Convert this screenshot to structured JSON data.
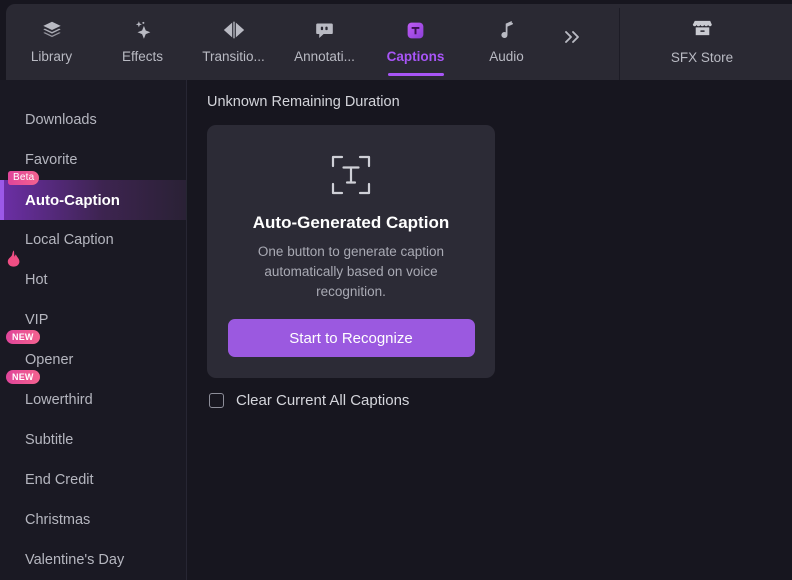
{
  "toolbar": {
    "tabs": [
      {
        "label": "Library",
        "icon": "layers-icon",
        "active": false
      },
      {
        "label": "Effects",
        "icon": "sparkle-icon",
        "active": false
      },
      {
        "label": "Transitio...",
        "icon": "transition-icon",
        "active": false
      },
      {
        "label": "Annotati...",
        "icon": "speech-bubble-icon",
        "active": false
      },
      {
        "label": "Captions",
        "icon": "captions-t-icon",
        "active": true
      },
      {
        "label": "Audio",
        "icon": "music-note-icon",
        "active": false
      }
    ],
    "overflow_icon": "chevron-double-right-icon",
    "store": {
      "label": "SFX Store",
      "icon": "storefront-icon"
    }
  },
  "sidebar": {
    "items": [
      {
        "label": "Downloads",
        "badge": null,
        "active": false
      },
      {
        "label": "Favorite",
        "badge": null,
        "active": false
      },
      {
        "label": "Auto-Caption",
        "badge": "Beta",
        "badge_type": "beta",
        "active": true
      },
      {
        "label": "Local Caption",
        "badge": null,
        "active": false
      },
      {
        "label": "Hot",
        "badge": null,
        "badge_type": "flame",
        "active": false
      },
      {
        "label": "VIP",
        "badge": null,
        "active": false
      },
      {
        "label": "Opener",
        "badge": "NEW",
        "badge_type": "new",
        "active": false
      },
      {
        "label": "Lowerthird",
        "badge": "NEW",
        "badge_type": "new",
        "active": false
      },
      {
        "label": "Subtitle",
        "badge": null,
        "active": false
      },
      {
        "label": "End Credit",
        "badge": null,
        "active": false
      },
      {
        "label": "Christmas",
        "badge": null,
        "active": false
      },
      {
        "label": "Valentine's Day",
        "badge": null,
        "active": false
      }
    ]
  },
  "main": {
    "heading": "Unknown Remaining Duration",
    "card": {
      "icon": "text-recognition-icon",
      "title": "Auto-Generated Caption",
      "description": "One button to generate caption automatically based on voice recognition.",
      "button_label": "Start to Recognize"
    },
    "clear_captions": {
      "label": "Clear Current All Captions",
      "checked": false
    }
  },
  "colors": {
    "accent_purple": "#a855f7",
    "button_purple": "#9b59e0",
    "badge_pink": "#e0459a",
    "toolbar_bg": "#2a2933",
    "sidebar_bg": "#1a1923",
    "panel_bg": "#17161f",
    "card_bg": "#2c2b36"
  }
}
